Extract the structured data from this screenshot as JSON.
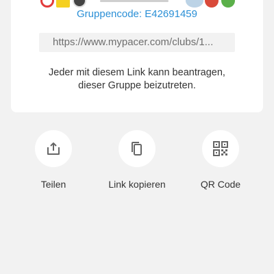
{
  "card": {
    "group_code": "Gruppencode: E42691459",
    "invite_link": "https://www.mypacer.com/clubs/1...",
    "info_line1": "Jeder mit diesem Link kann beantragen,",
    "info_line2": "dieser Gruppe beizutreten."
  },
  "actions": [
    {
      "label": "Teilen",
      "icon": "share-icon"
    },
    {
      "label": "Link kopieren",
      "icon": "copy-icon"
    },
    {
      "label": "QR Code",
      "icon": "qr-code-icon"
    }
  ],
  "colors": {
    "accent": "#2a8fd6",
    "background": "#f2f2f2",
    "card": "#ffffff",
    "icon": "#666666"
  }
}
